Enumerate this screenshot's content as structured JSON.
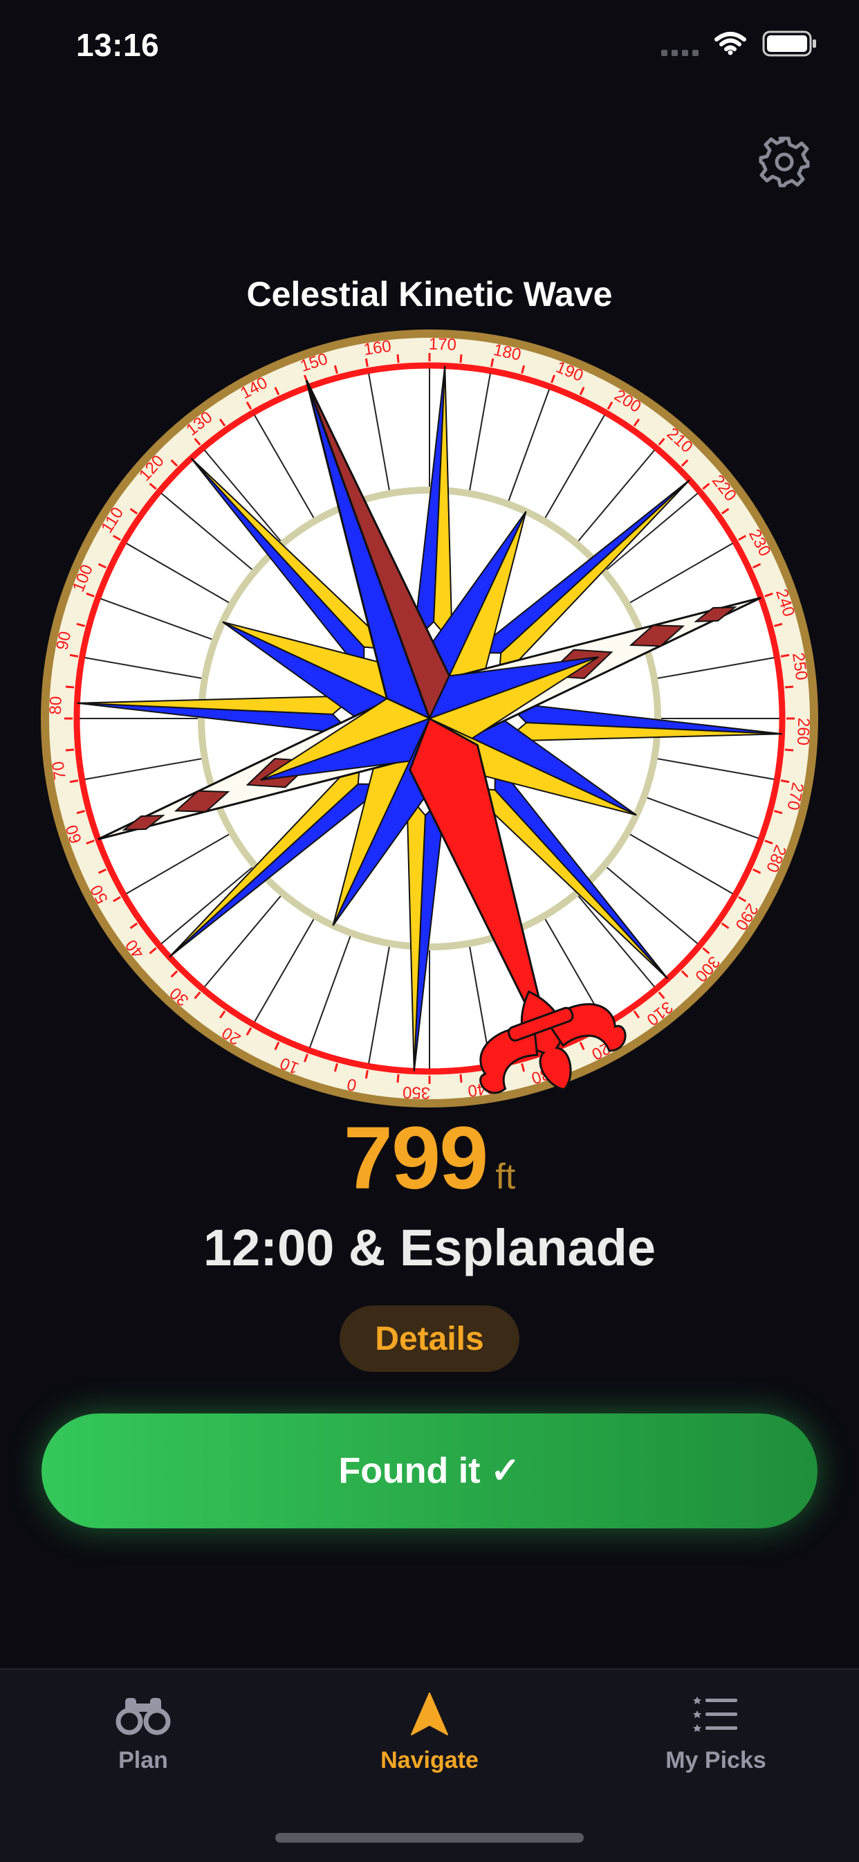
{
  "status_bar": {
    "time": "13:16",
    "signal": "signal-icon",
    "wifi": "wifi-icon",
    "battery": "battery-icon"
  },
  "header": {
    "settings_icon": "gear-icon"
  },
  "target": {
    "name": "Celestial Kinetic Wave"
  },
  "compass": {
    "icon": "compass-rose",
    "bearing_labels": [
      "0",
      "10",
      "20",
      "30",
      "40",
      "50",
      "60",
      "70",
      "80",
      "90",
      "100",
      "110",
      "120",
      "130",
      "140",
      "150",
      "160",
      "170",
      "180",
      "190",
      "200",
      "210",
      "220",
      "230",
      "240",
      "250",
      "260",
      "270",
      "280",
      "290",
      "300",
      "310",
      "320",
      "330",
      "340",
      "350"
    ],
    "colors": {
      "ring_red": "#ff1a1a",
      "rim_gold": "#a88338",
      "star_blue": "#1a2cff",
      "star_yellow": "#ffd21a",
      "north_red": "#ff1a1a",
      "south_maroon": "#a3302e"
    }
  },
  "distance": {
    "value": "799",
    "unit": "ft"
  },
  "location": {
    "address": "12:00 & Esplanade"
  },
  "actions": {
    "details_label": "Details",
    "found_label": "Found it ✓"
  },
  "tabs": [
    {
      "label": "Plan",
      "icon": "binoculars-icon",
      "active": false
    },
    {
      "label": "Navigate",
      "icon": "navigation-arrow-icon",
      "active": true
    },
    {
      "label": "My Picks",
      "icon": "list-stars-icon",
      "active": false
    }
  ],
  "theme": {
    "accent": "#f5a623",
    "success": "#34c759",
    "background": "#0b0b11"
  }
}
